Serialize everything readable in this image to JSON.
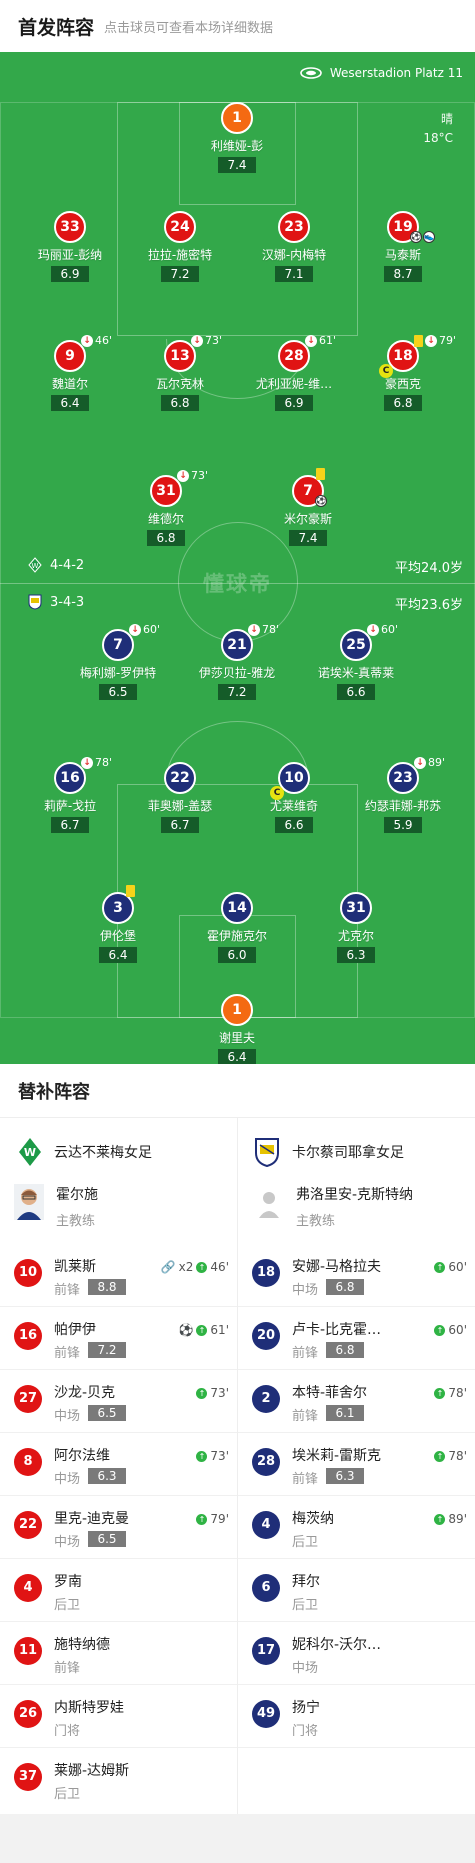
{
  "header": {
    "title": "首发阵容",
    "subtitle": "点击球员可查看本场详细数据"
  },
  "pitch": {
    "stadium": "Weserstadion Platz 11",
    "weather": "晴",
    "temp": "18°C",
    "watermark": "懂球帝",
    "home_formation": "4-4-2",
    "home_avg": "平均24.0岁",
    "away_formation": "3-4-3",
    "away_avg": "平均23.6岁"
  },
  "home_players": [
    {
      "num": "1",
      "name": "利维娅-彭",
      "rating": "7.4",
      "gk": true
    },
    {
      "num": "33",
      "name": "玛丽亚-彭纳",
      "rating": "6.9"
    },
    {
      "num": "24",
      "name": "拉拉-施密特",
      "rating": "7.2"
    },
    {
      "num": "23",
      "name": "汉娜-内梅特",
      "rating": "7.1"
    },
    {
      "num": "19",
      "name": "马泰斯",
      "rating": "8.7",
      "goal": true,
      "assist": true
    },
    {
      "num": "9",
      "name": "魏道尔",
      "rating": "6.4",
      "sub": "46'"
    },
    {
      "num": "13",
      "name": "瓦尔克林",
      "rating": "6.8",
      "sub": "73'"
    },
    {
      "num": "28",
      "name": "尤利亚妮-维…",
      "rating": "6.9",
      "sub": "61'"
    },
    {
      "num": "18",
      "name": "豪西克",
      "rating": "6.8",
      "sub": "79'",
      "yellow": true,
      "captain": true
    },
    {
      "num": "31",
      "name": "维德尔",
      "rating": "6.8",
      "sub": "73'"
    },
    {
      "num": "7",
      "name": "米尔豪斯",
      "rating": "7.4",
      "yellow": true,
      "goal": true
    }
  ],
  "away_players": [
    {
      "num": "7",
      "name": "梅利娜-罗伊特",
      "rating": "6.5",
      "sub": "60'"
    },
    {
      "num": "21",
      "name": "伊莎贝拉-雅龙",
      "rating": "7.2",
      "sub": "78'"
    },
    {
      "num": "25",
      "name": "诺埃米-真蒂莱",
      "rating": "6.6",
      "sub": "60'"
    },
    {
      "num": "16",
      "name": "莉萨-戈拉",
      "rating": "6.7",
      "sub": "78'"
    },
    {
      "num": "22",
      "name": "菲奥娜-盖瑟",
      "rating": "6.7"
    },
    {
      "num": "10",
      "name": "尤莱维奇",
      "rating": "6.6",
      "captain": true
    },
    {
      "num": "23",
      "name": "约瑟菲娜-邦苏",
      "rating": "5.9",
      "sub": "89'"
    },
    {
      "num": "3",
      "name": "伊伦堡",
      "rating": "6.4",
      "yellow": true
    },
    {
      "num": "14",
      "name": "霍伊施克尔",
      "rating": "6.0"
    },
    {
      "num": "31",
      "name": "尤克尔",
      "rating": "6.3"
    },
    {
      "num": "1",
      "name": "谢里夫",
      "rating": "6.4",
      "gk": true
    }
  ],
  "bench": {
    "title": "替补阵容",
    "home": {
      "team": "云达不莱梅女足",
      "coach": "霍尔施",
      "coach_role": "主教练",
      "subs": [
        {
          "num": "10",
          "name": "凯莱斯",
          "pos": "前锋",
          "rating": "8.8",
          "event": "x2",
          "in": "46'"
        },
        {
          "num": "16",
          "name": "帕伊伊",
          "pos": "前锋",
          "rating": "7.2",
          "in": "61'",
          "goal": true
        },
        {
          "num": "27",
          "name": "沙龙-贝克",
          "pos": "中场",
          "rating": "6.5",
          "in": "73'"
        },
        {
          "num": "8",
          "name": "阿尔法维",
          "pos": "中场",
          "rating": "6.3",
          "in": "73'"
        },
        {
          "num": "22",
          "name": "里克-迪克曼",
          "pos": "中场",
          "rating": "6.5",
          "in": "79'"
        },
        {
          "num": "4",
          "name": "罗南",
          "pos": "后卫"
        },
        {
          "num": "11",
          "name": "施特纳德",
          "pos": "前锋"
        },
        {
          "num": "26",
          "name": "内斯特罗娃",
          "pos": "门将"
        },
        {
          "num": "37",
          "name": "莱娜-达姆斯",
          "pos": "后卫"
        }
      ]
    },
    "away": {
      "team": "卡尔蔡司耶拿女足",
      "coach": "弗洛里安-克斯特纳",
      "coach_role": "主教练",
      "subs": [
        {
          "num": "18",
          "name": "安娜-马格拉夫",
          "pos": "中场",
          "rating": "6.8",
          "in": "60'"
        },
        {
          "num": "20",
          "name": "卢卡-比克霍…",
          "pos": "前锋",
          "rating": "6.8",
          "in": "60'"
        },
        {
          "num": "2",
          "name": "本特-菲舍尔",
          "pos": "前锋",
          "rating": "6.1",
          "in": "78'"
        },
        {
          "num": "28",
          "name": "埃米莉-雷斯克",
          "pos": "前锋",
          "rating": "6.3",
          "in": "78'"
        },
        {
          "num": "4",
          "name": "梅茨纳",
          "pos": "后卫",
          "in": "89'"
        },
        {
          "num": "6",
          "name": "拜尔",
          "pos": "后卫"
        },
        {
          "num": "17",
          "name": "妮科尔-沃尔…",
          "pos": "中场"
        },
        {
          "num": "49",
          "name": "扬宁",
          "pos": "门将"
        }
      ]
    }
  }
}
